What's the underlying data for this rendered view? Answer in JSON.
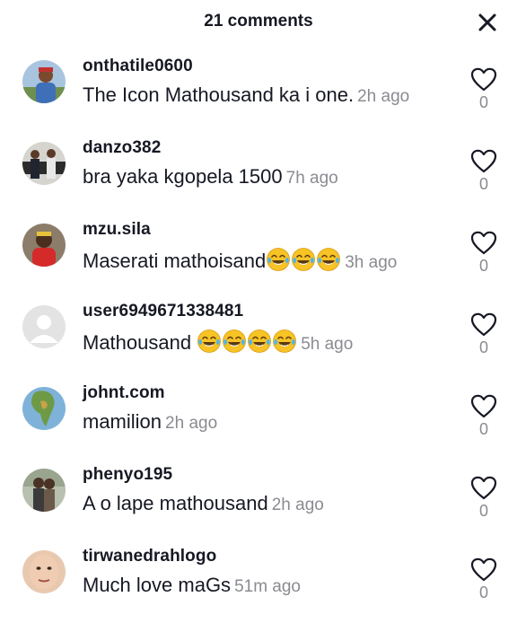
{
  "header": {
    "title": "21 comments"
  },
  "comments": [
    {
      "username": "onthatile0600",
      "text": "The Icon Mathousand ka i one.",
      "emoji_count": 0,
      "time": "2h ago",
      "likes": "0",
      "avatar": "photo-man-outdoors"
    },
    {
      "username": "danzo382",
      "text": "bra yaka kgopela 1500",
      "emoji_count": 0,
      "time": "7h ago",
      "likes": "0",
      "avatar": "photo-men-with-car"
    },
    {
      "username": "mzu.sila",
      "text": "Maserati mathoisand",
      "emoji_count": 3,
      "time": "3h ago",
      "likes": "0",
      "avatar": "photo-red-shirt"
    },
    {
      "username": "user6949671338481",
      "text": "Mathousand ",
      "emoji_count": 4,
      "time": "5h ago",
      "likes": "0",
      "avatar": "default-avatar"
    },
    {
      "username": "johnt.com",
      "text": "mamilion",
      "emoji_count": 0,
      "time": "2h ago",
      "likes": "0",
      "avatar": "photo-africa-map"
    },
    {
      "username": "phenyo195",
      "text": "A o lape mathousand",
      "emoji_count": 0,
      "time": "2h ago",
      "likes": "0",
      "avatar": "photo-couple"
    },
    {
      "username": "tirwanedrahlogo",
      "text": "Much love maGs",
      "emoji_count": 0,
      "time": "51m ago",
      "likes": "0",
      "avatar": "photo-face-closeup"
    }
  ],
  "colors": {
    "text": "#161823",
    "muted": "#8a8b91",
    "background": "#ffffff"
  },
  "icons": {
    "close": "close-icon",
    "like": "heart-outline-icon",
    "emoji": "face-with-tears-of-joy"
  }
}
